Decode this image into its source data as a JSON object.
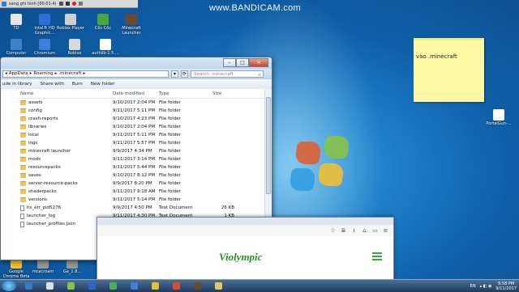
{
  "recorder": {
    "title": "sang ghi hình [00:01:4(",
    "controls": [
      "pause",
      "stop",
      "record",
      "screenshot"
    ]
  },
  "watermark": "www.BANDICAM.com",
  "desktop_icons": [
    {
      "label": "TD",
      "color": "#e6e6e6"
    },
    {
      "label": "Intel® HD Graphic...",
      "color": "#2c6fd6"
    },
    {
      "label": "Roblox Player",
      "color": "#cfcfcf"
    },
    {
      "label": "Cốc Cốc",
      "color": "#4aa63c"
    },
    {
      "label": "Minecraft Launcher",
      "color": "#6b4a2b"
    },
    {
      "label": "Computer",
      "color": "#3b83c9"
    },
    {
      "label": "Chromium",
      "color": "#3f7fd9"
    },
    {
      "label": "Roblox",
      "color": "#d9d9d9"
    },
    {
      "label": "authlib-1.5....",
      "color": "#ffffff"
    },
    {
      "label": "PortalGun-...",
      "color": "#ffffff"
    },
    {
      "label": "Google Chrome Beta",
      "color": "#f2c12e"
    },
    {
      "label": "mcacroam",
      "color": "#999999"
    },
    {
      "label": "Ga_1.8...",
      "color": "#999999"
    }
  ],
  "sticky_note": {
    "text": "vào .minecraft"
  },
  "explorer": {
    "address": [
      "AppData",
      "Roaming",
      ".minecraft"
    ],
    "search_placeholder": "Search .minecraft",
    "toolbar": [
      "ude in library",
      "Share with",
      "Burn",
      "New folder"
    ],
    "columns": [
      "Name",
      "Date modified",
      "Type",
      "Size"
    ],
    "files": [
      {
        "name": "assets",
        "date": "9/10/2017 2:04 PM",
        "type": "File folder",
        "size": "",
        "kind": "folder"
      },
      {
        "name": "config",
        "date": "9/11/2017 5:11 PM",
        "type": "File folder",
        "size": "",
        "kind": "folder"
      },
      {
        "name": "crash-reports",
        "date": "9/10/2017 4:23 PM",
        "type": "File folder",
        "size": "",
        "kind": "folder"
      },
      {
        "name": "libraries",
        "date": "9/10/2017 2:04 PM",
        "type": "File folder",
        "size": "",
        "kind": "folder"
      },
      {
        "name": "local",
        "date": "9/11/2017 5:11 PM",
        "type": "File folder",
        "size": "",
        "kind": "folder"
      },
      {
        "name": "logs",
        "date": "9/11/2017 5:57 PM",
        "type": "File folder",
        "size": "",
        "kind": "folder"
      },
      {
        "name": "minecraft launcher",
        "date": "9/9/2017 4:34 PM",
        "type": "File folder",
        "size": "",
        "kind": "folder"
      },
      {
        "name": "mods",
        "date": "9/11/2017 3:14 PM",
        "type": "File folder",
        "size": "",
        "kind": "folder"
      },
      {
        "name": "resourcepacks",
        "date": "9/11/2017 5:44 PM",
        "type": "File folder",
        "size": "",
        "kind": "folder"
      },
      {
        "name": "saves",
        "date": "9/10/2017 8:12 PM",
        "type": "File folder",
        "size": "",
        "kind": "folder"
      },
      {
        "name": "server-resource-packs",
        "date": "9/9/2017 8:20 PM",
        "type": "File folder",
        "size": "",
        "kind": "folder"
      },
      {
        "name": "shaderpacks",
        "date": "9/11/2017 9:18 AM",
        "type": "File folder",
        "size": "",
        "kind": "folder"
      },
      {
        "name": "versions",
        "date": "9/11/2017 5:14 PM",
        "type": "File folder",
        "size": "",
        "kind": "folder"
      },
      {
        "name": "hs_err_pid5276",
        "date": "9/9/2017 4:50 PM",
        "type": "Text Document",
        "size": "26 KB",
        "kind": "file"
      },
      {
        "name": "launcher_log",
        "date": "9/11/2017 4:30 PM",
        "type": "Text Document",
        "size": "1 KB",
        "kind": "file"
      },
      {
        "name": "launcher_profiles.json",
        "date": "9/11/2017 5:57 PM",
        "type": "JSON File",
        "size": "3 KB",
        "kind": "file"
      }
    ]
  },
  "browser": {
    "site": "Violympic"
  },
  "taskbar": {
    "lang": "EN",
    "time": "6:58 PM",
    "date": "9/11/2017",
    "apps": [
      "#3a78c9",
      "#e0e0e0",
      "#8bc34a",
      "#2b66c9",
      "#4caf50",
      "#3f7fd9",
      "#e6c229",
      "#d94f2b",
      "#6b4a2b",
      "#e9c467"
    ]
  }
}
